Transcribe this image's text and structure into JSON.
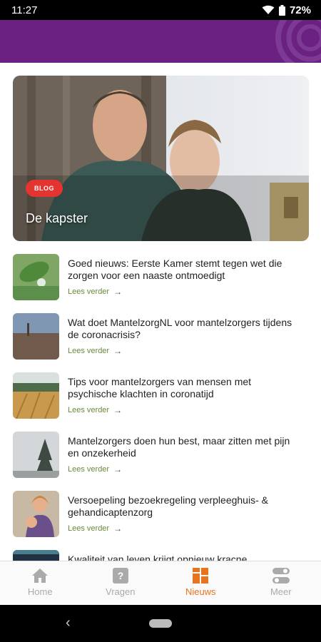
{
  "status": {
    "time": "11:27",
    "battery": "72%"
  },
  "hero": {
    "badge": "BLOG",
    "title": "De kapster"
  },
  "news": [
    {
      "title": "Goed nieuws: Eerste Kamer stemt tegen wet die zorgen voor een naaste ontmoedigt",
      "read_more": "Lees verder"
    },
    {
      "title": "Wat doet MantelzorgNL voor mantelzorgers tijdens de coronacrisis?",
      "read_more": "Lees verder"
    },
    {
      "title": "Tips voor mantelzorgers van mensen met psychische klachten in coronatijd",
      "read_more": "Lees verder"
    },
    {
      "title": "Mantelzorgers doen hun best, maar zitten met pijn en onzekerheid",
      "read_more": "Lees verder"
    },
    {
      "title": "Versoepeling bezoekregeling verpleeghuis- & gehandicaptenzorg",
      "read_more": "Lees verder"
    },
    {
      "title": "Kwaliteit van leven krijgt opnieuw kracne",
      "read_more": ""
    }
  ],
  "nav": [
    {
      "label": "Home",
      "icon": "home-icon"
    },
    {
      "label": "Vragen",
      "icon": "question-icon"
    },
    {
      "label": "Nieuws",
      "icon": "news-grid-icon"
    },
    {
      "label": "Meer",
      "icon": "toggle-icon"
    }
  ],
  "colors": {
    "header": "#6b2182",
    "active": "#e8731f",
    "badge": "#e3342f",
    "link": "#6a8a3a"
  }
}
